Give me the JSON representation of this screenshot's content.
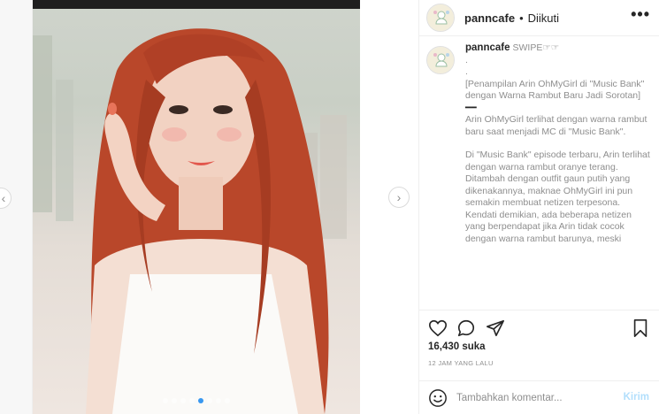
{
  "post": {
    "username": "panncafe",
    "separator": "•",
    "follow_label": "Diikuti",
    "more_label": "•••",
    "carousel": {
      "dot_count": 8,
      "active_index": 4
    }
  },
  "caption": {
    "username": "panncafe",
    "text_start": "SWIPE☞☞",
    "dot1": ".",
    "dot2": ".",
    "title": "[Penampilan Arin OhMyGirl di \"Music Bank\" dengan Warna Rambut Baru Jadi Sorotan]",
    "divider": "━━",
    "para1": "Arin OhMyGirl terlihat dengan warna rambut baru saat menjadi MC di \"Music Bank\".",
    "para2": "Di \"Music Bank\" episode terbaru, Arin terlihat dengan warna rambut oranye terang. Ditambah dengan outfit gaun putih yang dikenakannya, maknae OhMyGirl ini pun semakin membuat netizen terpesona. Kendati demikian, ada beberapa netizen yang berpendapat jika Arin tidak cocok dengan warna rambut barunya, meski"
  },
  "stats": {
    "likes": "16,430 suka",
    "time": "12 JAM YANG LALU"
  },
  "comment_box": {
    "placeholder": "Tambahkan komentar...",
    "post_label": "Kirim"
  },
  "icons": {
    "like": "heart-icon",
    "comment": "comment-bubble-icon",
    "share": "paper-plane-icon",
    "save": "bookmark-icon",
    "emoji": "smiley-icon",
    "prev": "chevron-left-icon",
    "next": "chevron-right-icon"
  },
  "colors": {
    "accent": "#3897f0",
    "post_disabled": "#b2dffc",
    "hair": "#b9472a"
  }
}
